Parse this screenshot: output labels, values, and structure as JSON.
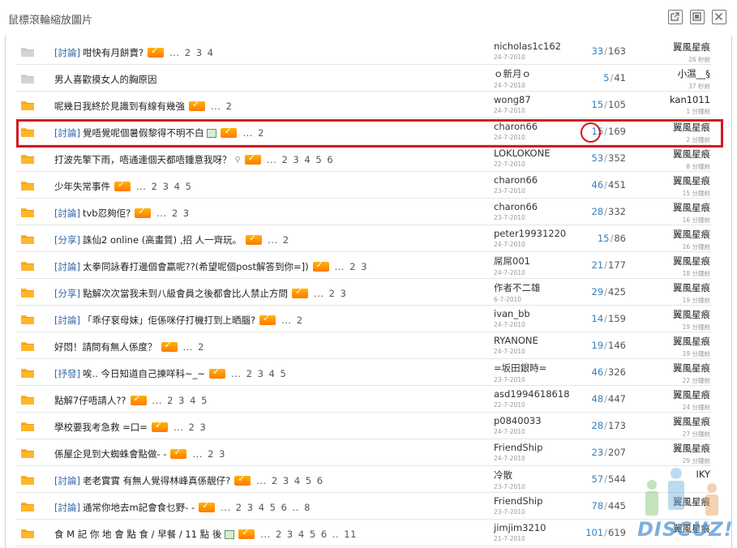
{
  "window": {
    "title": "鼠標滾輪縮放圖片",
    "buttons": {
      "open": "open-in-new-window",
      "max": "maximize",
      "close": "close"
    }
  },
  "threads": [
    {
      "folder": "grey",
      "tag": "[討論]",
      "title": "咁快有月餅賣?",
      "hot": true,
      "pages": "... 2 3 4",
      "author": "nicholas1c162",
      "date": "24-7-2010",
      "replies": "33",
      "views": "163",
      "last_user": "翼風星痕",
      "last_time": "26 秒前"
    },
    {
      "folder": "grey",
      "tag": "",
      "title": "男人喜歡摸女人的胸原因",
      "hot": false,
      "pages": "",
      "author": "ｏ新月ｏ",
      "date": "24-7-2010",
      "replies": "5",
      "views": "41",
      "last_user": "小濕__§",
      "last_time": "37 秒前"
    },
    {
      "folder": "yellow",
      "tag": "",
      "title": "呢幾日我終於見識到有線有幾強",
      "hot": true,
      "pages": "... 2",
      "author": "wong87",
      "date": "24-7-2010",
      "replies": "15",
      "views": "105",
      "last_user": "kan1011",
      "last_time": "1 分鐘前"
    },
    {
      "folder": "yellow",
      "tag": "[討論]",
      "title": "覺唔覺呢個暑假黎得不明不白",
      "img": true,
      "hot": true,
      "pages": "... 2",
      "author": "charon66",
      "date": "24-7-2010",
      "replies": "15",
      "views": "169",
      "last_user": "翼風星痕",
      "last_time": "2 分鐘前"
    },
    {
      "folder": "yellow",
      "tag": "",
      "title": "打波先擎下雨，唔通連個天都唔鍾意我呀？",
      "clip": true,
      "hot": true,
      "pages": "... 2 3 4 5 6",
      "author": "LOKLOKONE",
      "date": "22-7-2010",
      "replies": "53",
      "views": "352",
      "last_user": "翼風星痕",
      "last_time": "8 分鐘前"
    },
    {
      "folder": "yellow",
      "tag": "",
      "title": "少年失常事件",
      "hot": true,
      "pages": "... 2 3 4 5",
      "author": "charon66",
      "date": "23-7-2010",
      "replies": "46",
      "views": "451",
      "last_user": "翼風星痕",
      "last_time": "15 分鐘前"
    },
    {
      "folder": "yellow",
      "tag": "[討論]",
      "title": "tvb忍夠佢?",
      "hot": true,
      "pages": "... 2 3",
      "author": "charon66",
      "date": "23-7-2010",
      "replies": "28",
      "views": "332",
      "last_user": "翼風星痕",
      "last_time": "16 分鐘前"
    },
    {
      "folder": "yellow",
      "tag": "[分享]",
      "title": "誅仙2 online (高畫質) ,招 人一齊玩。",
      "hot": true,
      "pages": "... 2",
      "author": "peter19931220",
      "date": "24-7-2010",
      "replies": "15",
      "views": "86",
      "last_user": "翼風星痕",
      "last_time": "16 分鐘前"
    },
    {
      "folder": "yellow",
      "tag": "[討論]",
      "title": "太拳同詠春打邊個會贏呢??(希望呢個post解答到你=])",
      "hot": true,
      "pages": "... 2 3",
      "author": "屌屌001",
      "date": "24-7-2010",
      "replies": "21",
      "views": "177",
      "last_user": "翼風星痕",
      "last_time": "18 分鐘前"
    },
    {
      "folder": "yellow",
      "tag": "[分享]",
      "title": "點解次次當我未到八級會員之後都會比人禁止方問",
      "hot": true,
      "pages": "... 2 3",
      "author": "作者不二雄",
      "date": "6-7-2010",
      "replies": "29",
      "views": "425",
      "last_user": "翼風星痕",
      "last_time": "19 分鐘前"
    },
    {
      "folder": "yellow",
      "tag": "[討論]",
      "title": "「乖仔袞母妹」佢係咪仔打機打到上晒腦?",
      "hot": true,
      "pages": "... 2",
      "author": "ivan_bb",
      "date": "24-7-2010",
      "replies": "14",
      "views": "159",
      "last_user": "翼風星痕",
      "last_time": "19 分鐘前"
    },
    {
      "folder": "yellow",
      "tag": "",
      "title": "好悶！請問有無人係度？",
      "hot": true,
      "pages": "... 2",
      "author": "RYANONE",
      "date": "24-7-2010",
      "replies": "19",
      "views": "146",
      "last_user": "翼風星痕",
      "last_time": "19 分鐘前"
    },
    {
      "folder": "yellow",
      "tag": "[抒發]",
      "title": "唉.. 今日知道自己揀咩科~_~",
      "hot": true,
      "pages": "... 2 3 4 5",
      "author": "=坂田銀時=",
      "date": "23-7-2010",
      "replies": "46",
      "views": "326",
      "last_user": "翼風星痕",
      "last_time": "22 分鐘前"
    },
    {
      "folder": "yellow",
      "tag": "",
      "title": "點解7仔唔請人??",
      "hot": true,
      "pages": "... 2 3 4 5",
      "author": "asd1994618618",
      "date": "22-7-2010",
      "replies": "48",
      "views": "447",
      "last_user": "翼風星痕",
      "last_time": "24 分鐘前"
    },
    {
      "folder": "yellow",
      "tag": "",
      "title": "學校要我考急救 =口=",
      "hot": true,
      "pages": "... 2 3",
      "author": "p0840033",
      "date": "24-7-2010",
      "replies": "28",
      "views": "173",
      "last_user": "翼風星痕",
      "last_time": "27 分鐘前"
    },
    {
      "folder": "yellow",
      "tag": "",
      "title": "係屋企見到大蜘蛛會點做- -",
      "hot": true,
      "pages": "... 2 3",
      "author": "FriendShip",
      "date": "24-7-2010",
      "replies": "23",
      "views": "207",
      "last_user": "翼風星痕",
      "last_time": "29 分鐘前"
    },
    {
      "folder": "yellow",
      "tag": "[討論]",
      "title": "老老實實 有無人覺得林峰真係靚仔?",
      "hot": true,
      "pages": "... 2 3 4 5 6",
      "author": "冷散",
      "date": "23-7-2010",
      "replies": "57",
      "views": "544",
      "last_user": "IKY",
      "last_time": ""
    },
    {
      "folder": "yellow",
      "tag": "[討論]",
      "title": "通常你地去m記會食乜野- -",
      "hot": true,
      "pages": "... 2 3 4 5 6 .. 8",
      "author": "FriendShip",
      "date": "23-7-2010",
      "replies": "78",
      "views": "445",
      "last_user": "翼風星痕",
      "last_time": ""
    },
    {
      "folder": "yellow",
      "tag": "",
      "title": "食 M 記 你 地 會 點 食 / 早餐 / 11 點 後",
      "img": true,
      "hot": true,
      "pages": "... 2 3 4 5 6 .. 11",
      "author": "jimjim3210",
      "date": "21-7-2010",
      "replies": "101",
      "views": "619",
      "last_user": "翼風星痕",
      "last_time": ""
    }
  ],
  "watermark": {
    "text": "DISCUZ!"
  },
  "accent": {
    "highlight": "#d41920",
    "tag": "#3366aa",
    "replies": "#3380c0"
  }
}
